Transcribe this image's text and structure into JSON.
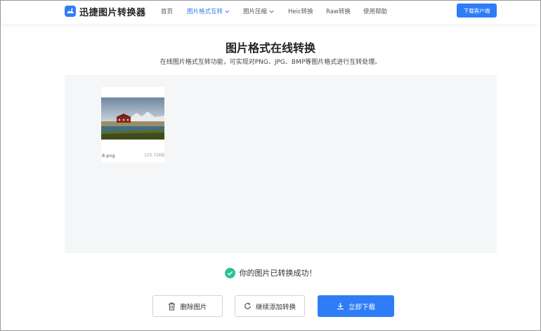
{
  "header": {
    "logo_text": "迅捷图片转换器",
    "nav": [
      {
        "label": "首页"
      },
      {
        "label": "图片格式互转"
      },
      {
        "label": "图片压缩"
      },
      {
        "label": "Heic转换"
      },
      {
        "label": "Raw转换"
      },
      {
        "label": "使用帮助"
      }
    ],
    "download_client": "下载客户端"
  },
  "main": {
    "title": "图片格式在线转换",
    "subtitle": "在线图片格式互转功能，可实现对PNG、JPG、BMP等图片格式进行互转处理。"
  },
  "file": {
    "name": "8.png",
    "size": "125.72KB"
  },
  "status": {
    "message": "你的图片已转换成功！"
  },
  "actions": {
    "delete_label": "删除图片",
    "continue_label": "继续添加转换",
    "download_label": "立即下载"
  },
  "colors": {
    "accent": "#2f7df6",
    "success": "#2cc197",
    "panel_bg": "#f5f6f8"
  }
}
